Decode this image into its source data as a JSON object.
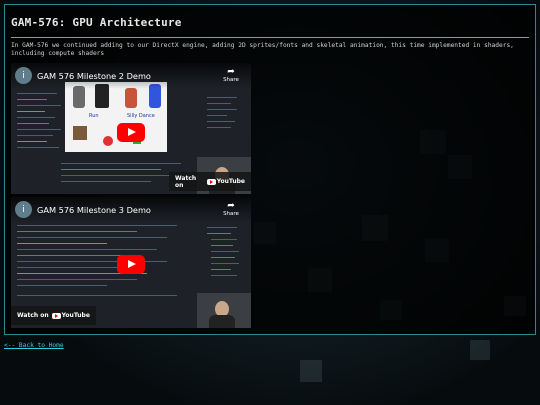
{
  "page": {
    "title": "GAM-576: GPU Architecture",
    "description": "In GAM-576 we continued adding to our DirectX engine, adding 2D sprites/fonts and skeletal animation, this time implemented in shaders, including compute shaders",
    "back_link": "<-- Back to Home"
  },
  "videos": [
    {
      "title": "GAM 576 Milestone 2 Demo",
      "share_label": "Share",
      "watch_label": "Watch on",
      "brand": "YouTube",
      "overlay_labels": [
        "Run",
        "Silly Dance"
      ]
    },
    {
      "title": "GAM 576 Milestone 3 Demo",
      "share_label": "Share",
      "watch_label": "Watch on",
      "brand": "YouTube"
    }
  ],
  "colors": {
    "accent": "#2ad3e0",
    "panel_border": "#2a8a8e",
    "youtube_red": "#ff0000"
  }
}
